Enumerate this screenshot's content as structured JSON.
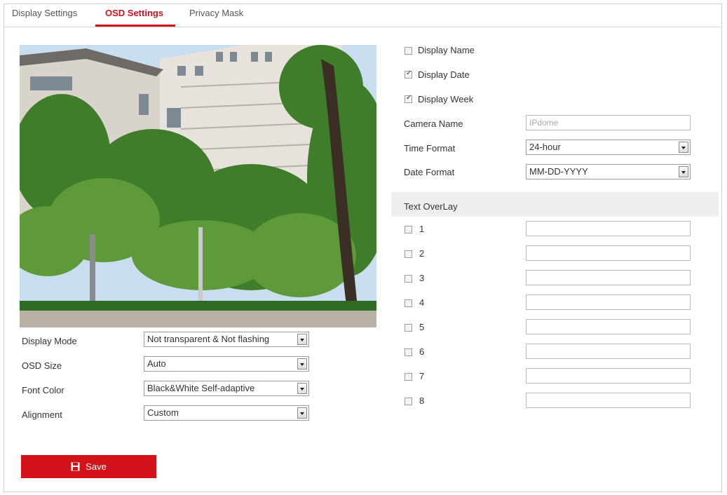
{
  "tabs": [
    {
      "label": "Display Settings"
    },
    {
      "label": "OSD Settings"
    },
    {
      "label": "Privacy Mask"
    }
  ],
  "left_settings": [
    {
      "label": "Display Mode",
      "value": "Not transparent & Not flashing"
    },
    {
      "label": "OSD Size",
      "value": "Auto"
    },
    {
      "label": "Font Color",
      "value": "Black&White Self-adaptive"
    },
    {
      "label": "Alignment",
      "value": "Custom"
    }
  ],
  "checkboxes": [
    {
      "label": "Display Name",
      "checked": false
    },
    {
      "label": "Display Date",
      "checked": true
    },
    {
      "label": "Display Week",
      "checked": true
    }
  ],
  "camera_name": {
    "label": "Camera Name",
    "value": "IPdome"
  },
  "time_format": {
    "label": "Time Format",
    "value": "24-hour"
  },
  "date_format": {
    "label": "Date Format",
    "value": "MM-DD-YYYY"
  },
  "text_overlay": {
    "title": "Text OverLay",
    "rows": [
      {
        "label": "1",
        "value": ""
      },
      {
        "label": "2",
        "value": ""
      },
      {
        "label": "3",
        "value": ""
      },
      {
        "label": "4",
        "value": ""
      },
      {
        "label": "5",
        "value": ""
      },
      {
        "label": "6",
        "value": ""
      },
      {
        "label": "7",
        "value": ""
      },
      {
        "label": "8",
        "value": ""
      }
    ]
  },
  "save_label": "Save",
  "colors": {
    "accent": "#d3121a"
  }
}
